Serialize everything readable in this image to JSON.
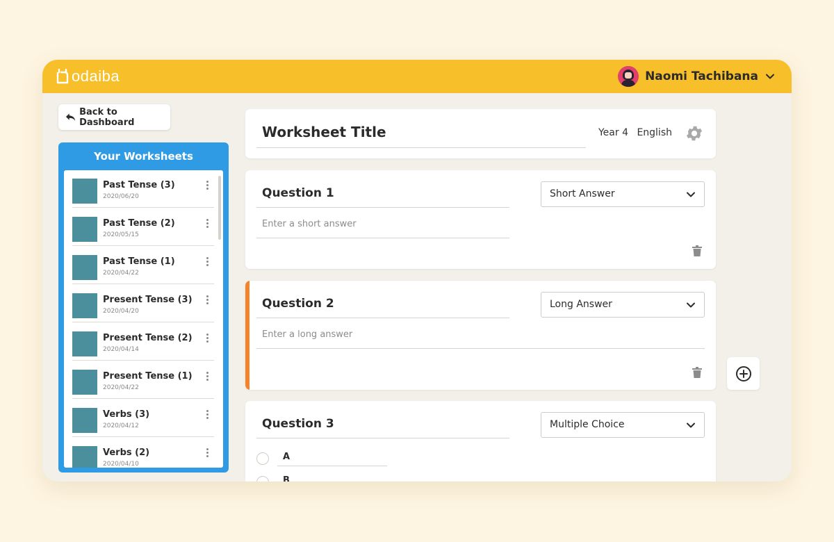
{
  "app": {
    "logo_text": "odaiba",
    "brand_color": "#f7bf2a",
    "accent_color": "#2f9be4",
    "active_color": "#f5832a"
  },
  "user": {
    "name": "Naomi Tachibana"
  },
  "nav": {
    "back_label": "Back to Dashboard"
  },
  "worksheets": {
    "title": "Your Worksheets",
    "items": [
      {
        "name": "Past Tense (3)",
        "date": "2020/06/20"
      },
      {
        "name": "Past Tense (2)",
        "date": "2020/05/15"
      },
      {
        "name": "Past Tense (1)",
        "date": "2020/04/22"
      },
      {
        "name": "Present Tense (3)",
        "date": "2020/04/20"
      },
      {
        "name": "Present Tense (2)",
        "date": "2020/04/14"
      },
      {
        "name": "Present Tense (1)",
        "date": "2020/04/22"
      },
      {
        "name": "Verbs (3)",
        "date": "2020/04/12"
      },
      {
        "name": "Verbs (2)",
        "date": "2020/04/10"
      }
    ]
  },
  "editor": {
    "title": "Worksheet Title",
    "year": "Year 4",
    "subject": "English",
    "questions": [
      {
        "title": "Question 1",
        "type": "Short Answer",
        "answer_placeholder": "Enter a short answer"
      },
      {
        "title": "Question 2",
        "type": "Long Answer",
        "answer_placeholder": "Enter a long answer"
      },
      {
        "title": "Question 3",
        "type": "Multiple Choice",
        "choices": [
          "A",
          "B"
        ]
      }
    ]
  },
  "icons": {
    "logo": "odaiba-logo-icon",
    "back": "reply-arrow-icon",
    "chevron": "chevron-down-icon",
    "menu": "kebab-menu-icon",
    "settings": "gear-icon",
    "delete": "trash-icon",
    "add": "plus-circle-icon"
  }
}
